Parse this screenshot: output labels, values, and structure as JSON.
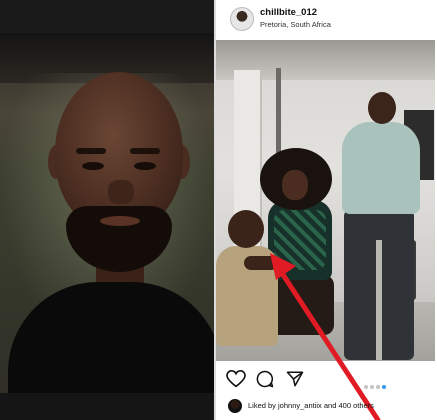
{
  "post": {
    "username": "chillbite_012",
    "location": "Pretoria, South Africa",
    "likes_text": "Liked by johnny_antiix and 400 others"
  },
  "actions": {
    "like_icon": "heart-icon",
    "comment_icon": "comment-icon",
    "share_icon": "send-icon"
  },
  "carousel": {
    "count": 4,
    "active_index": 3
  },
  "colors": {
    "annotation_arrow": "#e01b24",
    "active_dot": "#3897f0"
  }
}
